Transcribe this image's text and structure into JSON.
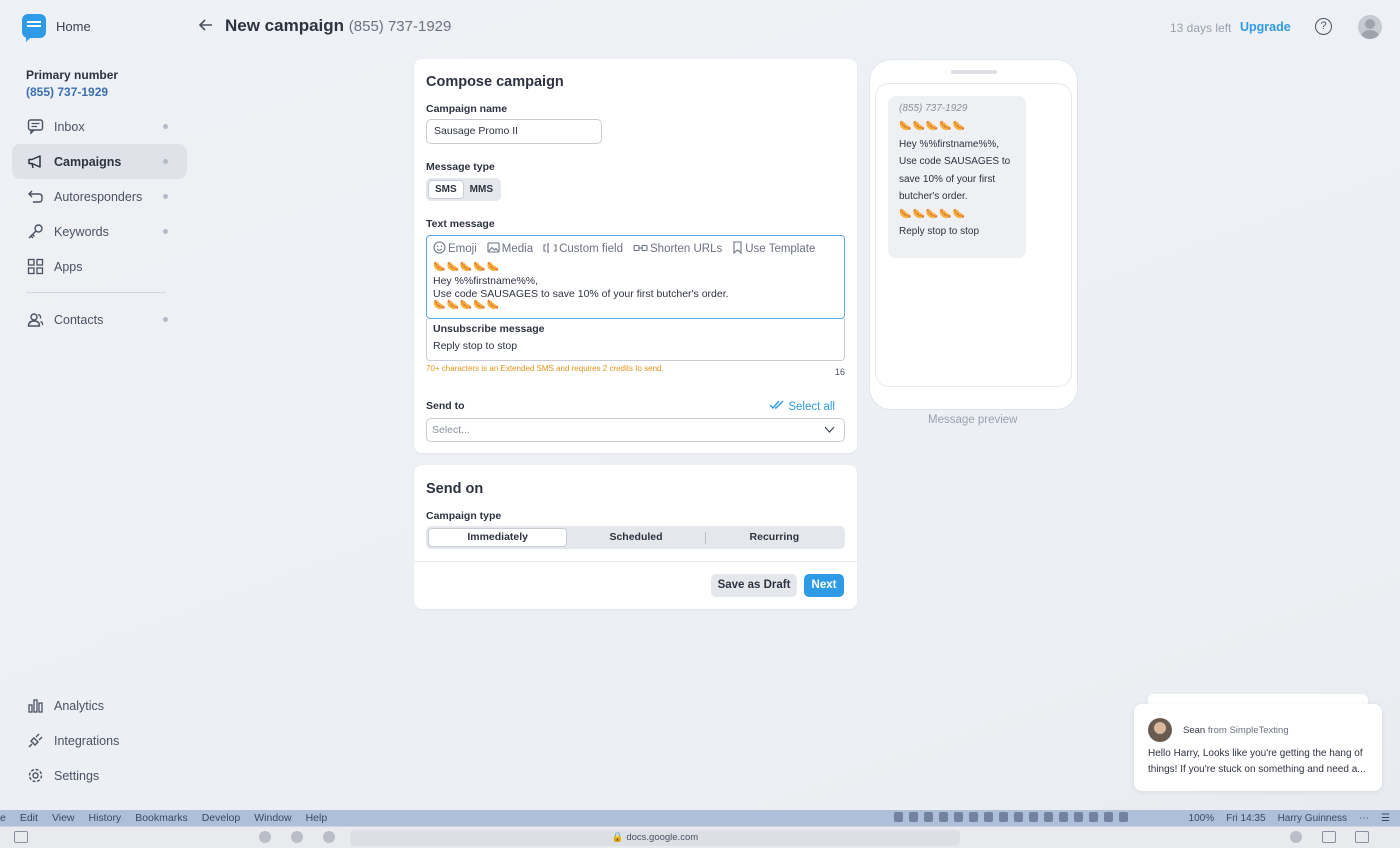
{
  "sidebar": {
    "home": "Home",
    "primary_label": "Primary number",
    "primary_number": "(855) 737-1929",
    "items": [
      {
        "label": "Inbox"
      },
      {
        "label": "Campaigns"
      },
      {
        "label": "Autoresponders"
      },
      {
        "label": "Keywords"
      },
      {
        "label": "Apps"
      },
      {
        "label": "Contacts"
      }
    ],
    "bottom_items": [
      {
        "label": "Analytics"
      },
      {
        "label": "Integrations"
      },
      {
        "label": "Settings"
      }
    ]
  },
  "header": {
    "title": "New campaign",
    "number": "(855) 737-1929",
    "days_left": "13 days left",
    "upgrade": "Upgrade"
  },
  "compose": {
    "title": "Compose campaign",
    "name_label": "Campaign name",
    "name_value": "Sausage Promo II",
    "type_label": "Message type",
    "type_options": [
      "SMS",
      "MMS"
    ],
    "text_label": "Text message",
    "tools": [
      "Emoji",
      "Media",
      "Custom field",
      "Shorten URLs",
      "Use Template"
    ],
    "message_lines": [
      "🌭🌭🌭🌭🌭",
      "Hey %%firstname%%,",
      "Use code SAUSAGES to save 10% of your first butcher's order.",
      "🌭🌭🌭🌭🌭"
    ],
    "unsub_label": "Unsubscribe message",
    "unsub_text": "Reply stop to stop",
    "warning": "70+ characters is an Extended SMS and requires 2 credits to send.",
    "char_count": "16",
    "send_to_label": "Send to",
    "select_all": "Select all",
    "select_placeholder": "Select..."
  },
  "send_on": {
    "title": "Send on",
    "type_label": "Campaign type",
    "options": [
      "Immediately",
      "Scheduled",
      "Recurring"
    ],
    "draft": "Save as Draft",
    "next": "Next"
  },
  "preview": {
    "number": "(855) 737-1929",
    "lines": [
      "🌭🌭🌭🌭🌭",
      "Hey %%firstname%%,",
      "Use code SAUSAGES to",
      "save 10% of your first",
      "butcher's order.",
      "🌭🌭🌭🌭🌭",
      "Reply stop to stop"
    ],
    "label": "Message preview"
  },
  "chat": {
    "name": "Sean",
    "from": "from SimpleTexting",
    "text": "Hello Harry, Looks like you're getting the hang of things! If you're stuck on something and need a..."
  },
  "menubar": {
    "items": [
      "e",
      "Edit",
      "View",
      "History",
      "Bookmarks",
      "Develop",
      "Window",
      "Help"
    ],
    "battery": "100%",
    "clock": "Fri 14:35",
    "user": "Harry Guinness"
  },
  "browser": {
    "url": "docs.google.com"
  },
  "colors": {
    "accent": "#2f9be6",
    "warning": "#e3941c"
  }
}
